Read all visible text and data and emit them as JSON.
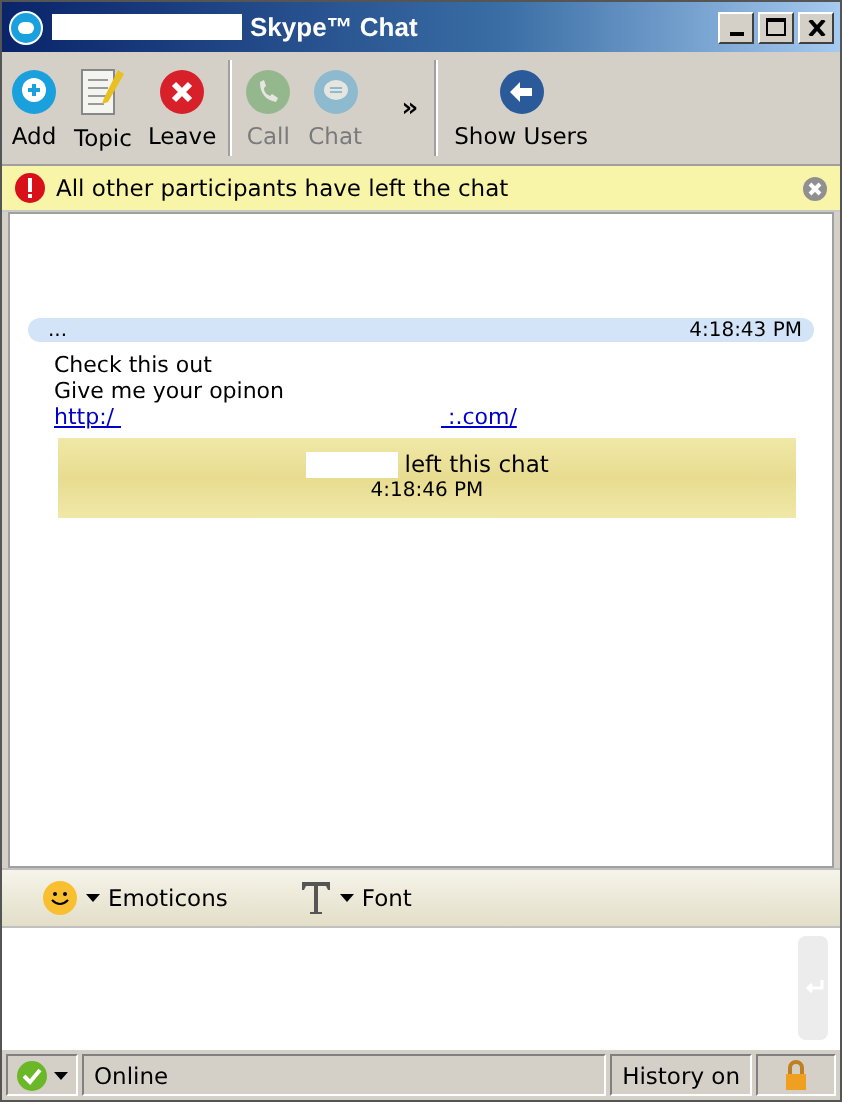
{
  "window": {
    "title": "Skype™ Chat"
  },
  "toolbar": {
    "buttons": [
      {
        "label": "Add",
        "kind": "add",
        "disabled": false
      },
      {
        "label": "Topic",
        "kind": "topic",
        "disabled": false
      },
      {
        "label": "Leave",
        "kind": "leave",
        "disabled": false
      },
      {
        "label": "Call",
        "kind": "call",
        "disabled": true
      },
      {
        "label": "Chat",
        "kind": "chat",
        "disabled": true
      }
    ],
    "overflow": "»",
    "show_users": "Show Users"
  },
  "alert": {
    "text": "All other participants have left the chat"
  },
  "messages": [
    {
      "kind": "message",
      "sender": "...",
      "time": "4:18:43 PM",
      "lines": [
        "Check this out",
        "Give me your opinon"
      ],
      "link_start": "http:/",
      "link_end": ":.com/"
    },
    {
      "kind": "event",
      "text": "left this chat",
      "time": "4:18:46 PM"
    }
  ],
  "format_bar": {
    "emoticons": "Emoticons",
    "font": "Font"
  },
  "status_bar": {
    "status": "Online",
    "history": "History on"
  }
}
